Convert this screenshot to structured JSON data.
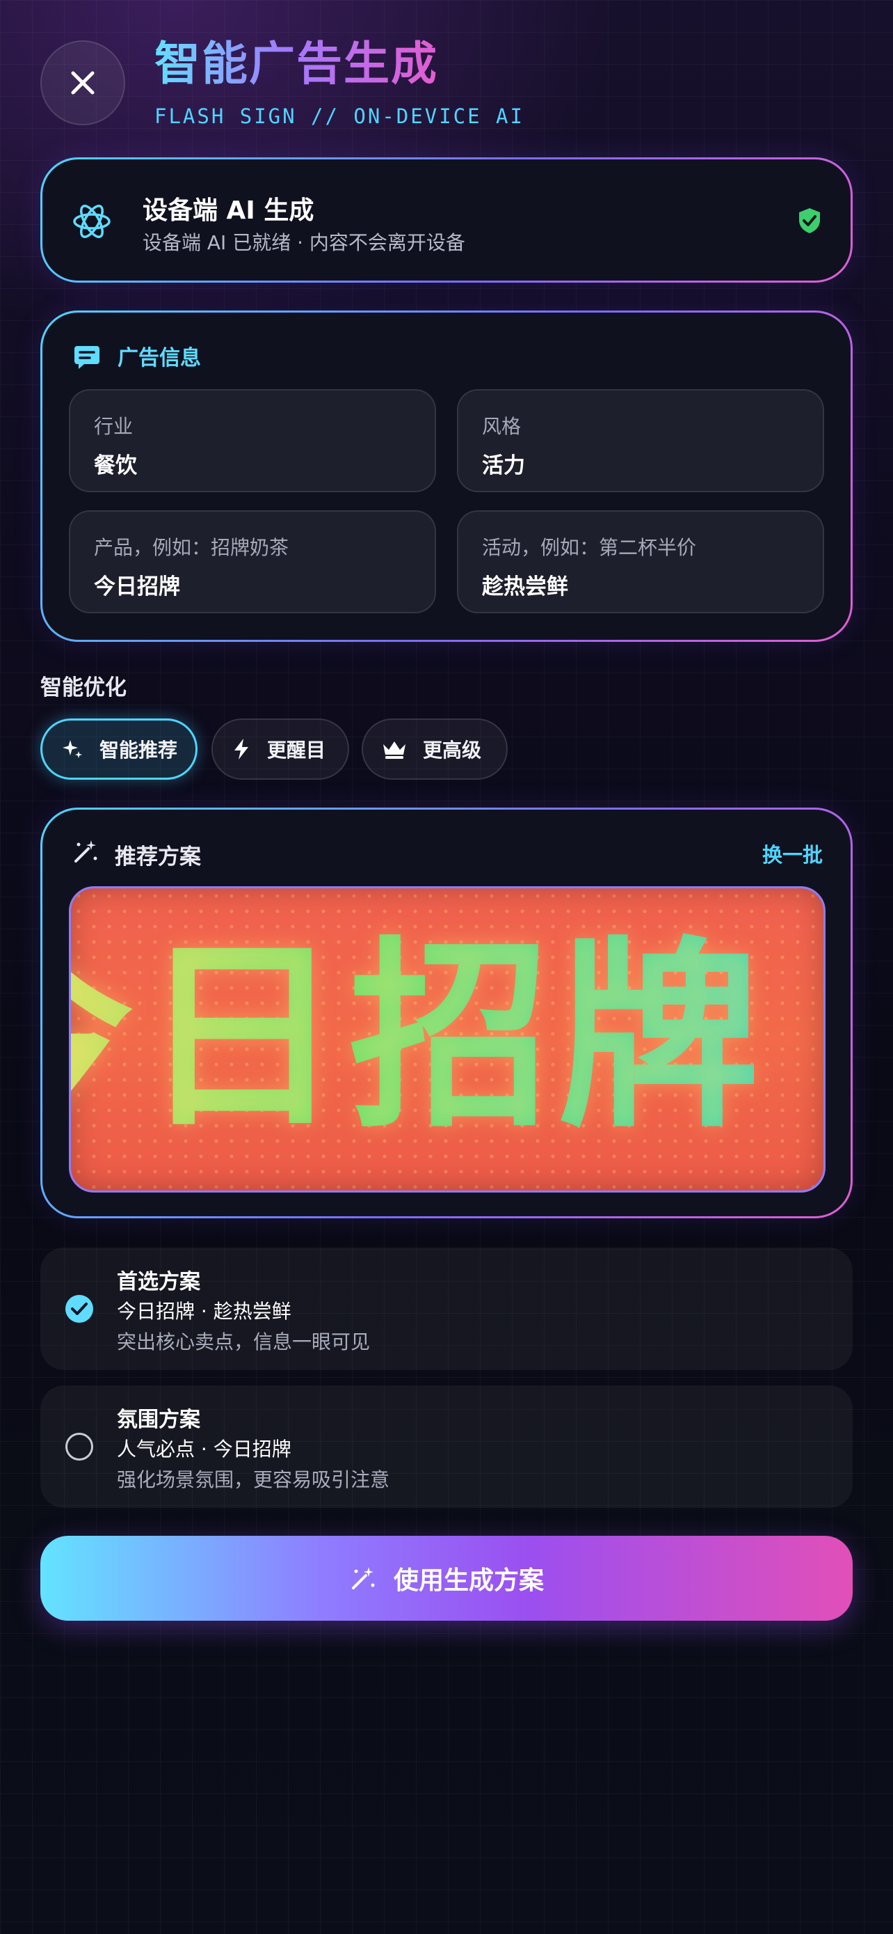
{
  "header": {
    "title": "智能广告生成",
    "subtitle": "FLASH SIGN // ON-DEVICE AI"
  },
  "ai_status": {
    "title": "设备端 AI 生成",
    "subtitle": "设备端 AI 已就绪 · 内容不会离开设备"
  },
  "ad_info": {
    "section_label": "广告信息",
    "fields": [
      {
        "label": "行业",
        "value": "餐饮"
      },
      {
        "label": "风格",
        "value": "活力"
      },
      {
        "label": "产品，例如：招牌奶茶",
        "value": "今日招牌"
      },
      {
        "label": "活动，例如：第二杯半价",
        "value": "趁热尝鲜"
      }
    ]
  },
  "optimize": {
    "title": "智能优化",
    "chips": [
      {
        "label": "智能推荐",
        "icon": "sparkle-icon",
        "active": true
      },
      {
        "label": "更醒目",
        "icon": "bolt-icon",
        "active": false
      },
      {
        "label": "更高级",
        "icon": "crown-icon",
        "active": false
      }
    ]
  },
  "recommendation": {
    "title": "推荐方案",
    "refresh_label": "换一批",
    "preview_text": "今日招牌 · 趁热尝鲜"
  },
  "plans": [
    {
      "heading": "首选方案",
      "main": "今日招牌 · 趁热尝鲜",
      "desc": "突出核心卖点，信息一眼可见",
      "selected": true
    },
    {
      "heading": "氛围方案",
      "main": "人气必点 · 今日招牌",
      "desc": "强化场景氛围，更容易吸引注意",
      "selected": false
    }
  ],
  "cta": {
    "label": "使用生成方案"
  },
  "colors": {
    "accent_cyan": "#4dd6ff",
    "accent_purple": "#9b4ff0",
    "accent_pink": "#e24fb8",
    "check_green": "#3ccf6e"
  }
}
